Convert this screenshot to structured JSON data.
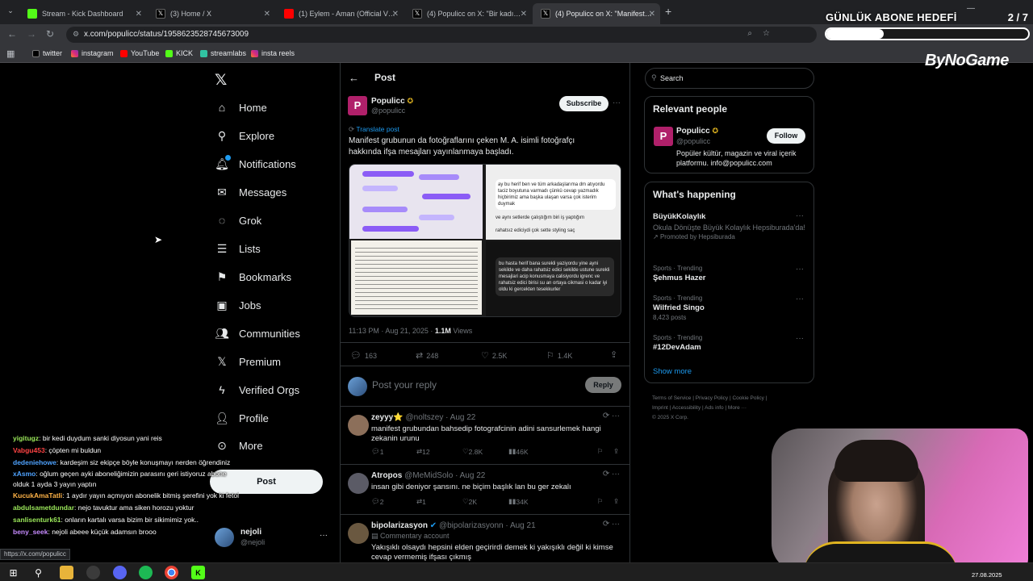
{
  "browser": {
    "tabs": [
      {
        "label": "Stream - Kick Dashboard",
        "color": "#53fc18",
        "active": false
      },
      {
        "label": "(3) Home / X",
        "color": "#000000",
        "active": false
      },
      {
        "label": "(1) Eylem - Aman (Official Video)",
        "color": "#ff0000",
        "active": false
      },
      {
        "label": "(4) Populicc on X: \"Bir kadın, M...",
        "color": "#000000",
        "active": false
      },
      {
        "label": "(4) Populicc on X: \"Manifest gru...",
        "color": "#000000",
        "active": true
      }
    ],
    "url": "x.com/populicc/status/1958623528745673009",
    "bookmarks": [
      "twitter",
      "instagram",
      "YouTube",
      "KICK",
      "streamlabs",
      "insta reels"
    ],
    "status_url": "https://x.com/populicc"
  },
  "overlay": {
    "goal_title": "GÜNLÜK ABONE HEDEFİ",
    "goal_count": "2 / 7",
    "goal_progress": 0.2857,
    "brand": "ByNoGame"
  },
  "nav": {
    "items": [
      "Home",
      "Explore",
      "Notifications",
      "Messages",
      "Grok",
      "Lists",
      "Bookmarks",
      "Jobs",
      "Communities",
      "Premium",
      "Verified Orgs",
      "Profile",
      "More"
    ],
    "post_button": "Post",
    "account_name": "nejoli",
    "account_handle": "@nejoli"
  },
  "post": {
    "header": "Post",
    "author_name": "Populicc",
    "author_handle": "@populicc",
    "subscribe": "Subscribe",
    "translate": "Translate post",
    "text": "Manifest grubunun da fotoğraflarını çeken M. A. isimli fotoğrafçı hakkında ifşa mesajları yayınlanmaya başladı.",
    "time": "11:13 PM · Aug 21, 2025 · ",
    "views_count": "1.1M",
    "views_label": " Views",
    "replies": "163",
    "reposts": "248",
    "likes": "2.5K",
    "bookmarks": "1.4K",
    "reply_placeholder": "Post your reply",
    "reply_button": "Reply",
    "image_texts": {
      "msg1": "ay bu herif ben ve tüm arkadaşlarıma dm atıyordu taciz boyutuna varmadı çünkü cevap yazmadık hiçbirimiz ama başka ulaşan varsa çok isterim duymak",
      "msg2": "ve aynı setlerde çalıştığım biri iş yaptığım",
      "msg3": "rahatsız ediciydi çok sette styling saç",
      "msg4": "bu hasta herif bana surekli yaziyordu yine ayni sekilde ve daha rahatsiz edici sekilde ustune surekli mesajlari acip konusmaya calisiyordu igrenc ve rahatsiz edici birisi su an ortaya cikmasi o kadar iyi oldu ki gercekten tesekkurler"
    }
  },
  "replies": [
    {
      "name": "zeyyy⭐",
      "handle": "@noltszey · Aug 22",
      "text": "manifest grubundan bahsedip fotografcinin adini sansurlemek hangi zekanin urunu",
      "r": "1",
      "rt": "12",
      "l": "2.8K",
      "v": "46K",
      "sub": ""
    },
    {
      "name": "Atropos",
      "handle": "@MeMidSolo · Aug 22",
      "text": "insan gibi deniyor şansını. ne biçim başlık lan bu ger zekalı",
      "r": "2",
      "rt": "1",
      "l": "2K",
      "v": "34K",
      "sub": ""
    },
    {
      "name": "bipolarizasyon",
      "handle": "@bipolarizasyonn · Aug 21",
      "text": "Yakışıklı olsaydı hepsini elden geçirirdi demek ki yakışıklı değil ki kimse cevap vermemiş ifşası çıkmış",
      "r": "",
      "rt": "",
      "l": "",
      "v": "",
      "sub": "Commentary account"
    }
  ],
  "right": {
    "search_placeholder": "Search",
    "relevant_title": "Relevant people",
    "person_name": "Populicc",
    "person_handle": "@populicc",
    "follow": "Follow",
    "person_bio": "Popüler kültür, magazin ve viral içerik platformu. info@populicc.com",
    "happening_title": "What's happening",
    "trends": [
      {
        "context": "",
        "name": "BüyükKolaylık",
        "sub1": "Okula Dönüşte Büyük Kolaylık Hepsiburada'da!",
        "sub2": "Promoted by Hepsiburada"
      },
      {
        "context": "Sports · Trending",
        "name": "Şehmus Hazer",
        "sub1": "",
        "sub2": ""
      },
      {
        "context": "Sports · Trending",
        "name": "Wilfried Singo",
        "sub1": "8,423 posts",
        "sub2": ""
      },
      {
        "context": "Sports · Trending",
        "name": "#12DevAdam",
        "sub1": "",
        "sub2": ""
      }
    ],
    "show_more": "Show more",
    "footer_line1": "Terms of Service  |  Privacy Policy  |  Cookie Policy  |",
    "footer_line2": "Imprint  |  Accessibility  |  Ads info  |  More ···",
    "footer_line3": "© 2025 X Corp."
  },
  "chat": [
    {
      "user": "yigitugz",
      "color": "#9be85a",
      "msg": ": bir kedi duydum sanki diyosun yani reis"
    },
    {
      "user": "Vabgu453",
      "color": "#ff4444",
      "msg": ": çöpten mi buldun"
    },
    {
      "user": "dedeniehowe",
      "color": "#4fa3ff",
      "msg": ": kardeşim siz ekipçe böyle konuşmayı nerden öğrendiniz"
    },
    {
      "user": "xAsmo",
      "color": "#4fa3ff",
      "msg": ": oğlum geçen ayki aboneliğimizin parasını geri istiyoruz abone olduk 1 ayda 3 yayın yaptın"
    },
    {
      "user": "KucukAmaTatli",
      "color": "#ffb347",
      "msg": ": 1 aydır yayın açmıyon abonelik bitmiş şerefini yok ki fetoli"
    },
    {
      "user": "abdulsametdundar",
      "color": "#9be85a",
      "msg": ": nejo tavuktur ama siken horozu yoktur"
    },
    {
      "user": "sanlisenturk61",
      "color": "#9be85a",
      "msg": ": onların kartalı varsa bizim bir sikimimiz yok.."
    },
    {
      "user": "beny_seek",
      "color": "#c78bff",
      "msg": ": nejoli abeee küçük adamsın brooo"
    }
  ],
  "taskbar": {
    "clock": "27.08.2025"
  }
}
